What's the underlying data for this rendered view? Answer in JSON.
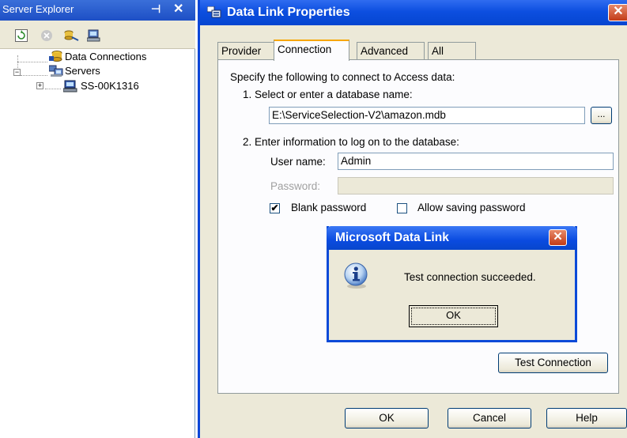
{
  "server_explorer": {
    "title": "Server Explorer",
    "pin_glyph": "⊣",
    "close_glyph": "✕",
    "tree": [
      {
        "label": "Data Connections",
        "icon": "data-connections-icon"
      },
      {
        "label": "Servers",
        "icon": "servers-icon",
        "expander": "−"
      },
      {
        "label": "SS-00K1316",
        "icon": "computer-icon",
        "expander": "+"
      }
    ]
  },
  "dialog": {
    "title": "Data Link Properties",
    "close_glyph": "✕",
    "tabs": [
      {
        "label": "Provider"
      },
      {
        "label": "Connection"
      },
      {
        "label": "Advanced"
      },
      {
        "label": "All"
      }
    ],
    "intro": "Specify the following to connect to Access data:",
    "step1_label": "1. Select or enter a database name:",
    "database_name": "E:\\ServiceSelection-V2\\amazon.mdb",
    "browse_label": "...",
    "step2_label": "2. Enter information to log on to the database:",
    "username_label": "User name:",
    "username_value": "Admin",
    "password_label": "Password:",
    "password_value": "",
    "blank_password_label": "Blank password",
    "blank_password_checked": "✔",
    "allow_saving_label": "Allow saving password",
    "test_connection_label": "Test Connection",
    "ok_label": "OK",
    "cancel_label": "Cancel",
    "help_label": "Help"
  },
  "message_box": {
    "title": "Microsoft Data Link",
    "close_glyph": "✕",
    "message": "Test connection succeeded.",
    "ok_label": "OK"
  }
}
